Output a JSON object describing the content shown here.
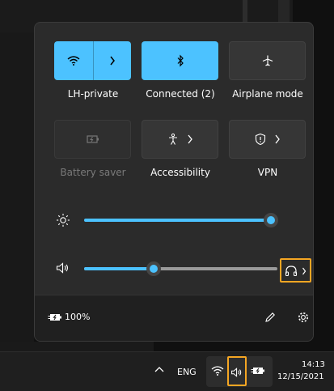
{
  "quick_settings": {
    "tiles": [
      {
        "label": "LH-private",
        "state": "on",
        "icon": "wifi-icon",
        "has_chevron": true
      },
      {
        "label": "Connected (2)",
        "state": "on",
        "icon": "bluetooth-icon",
        "has_chevron": false
      },
      {
        "label": "Airplane mode",
        "state": "off",
        "icon": "airplane-icon",
        "has_chevron": false
      },
      {
        "label": "Battery saver",
        "state": "disabled",
        "icon": "battery-saver-icon",
        "has_chevron": false
      },
      {
        "label": "Accessibility",
        "state": "off",
        "icon": "accessibility-icon",
        "has_chevron": true
      },
      {
        "label": "VPN",
        "state": "off",
        "icon": "vpn-shield-icon",
        "has_chevron": true
      }
    ],
    "brightness_level": 1.0,
    "volume_level": 0.36,
    "battery_percent": "100%"
  },
  "taskbar": {
    "language": "ENG",
    "time": "14:13",
    "date": "12/15/2021"
  },
  "colors": {
    "accent": "#4cc2ff",
    "highlight": "#f5a623"
  }
}
